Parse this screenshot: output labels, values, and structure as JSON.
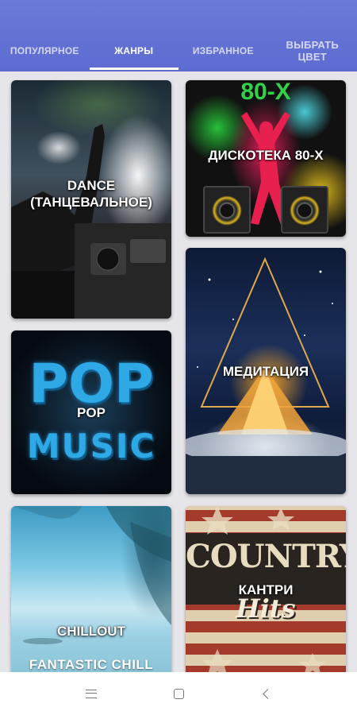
{
  "tabs": [
    {
      "label": "ПОПУЛЯРНОЕ",
      "active": false
    },
    {
      "label": "ЖАНРЫ",
      "active": true
    },
    {
      "label": "ИЗБРАННОЕ",
      "active": false
    },
    {
      "label": "ВЫБРАТЬ ЦВЕТ",
      "active": false
    }
  ],
  "genres": [
    {
      "title": "DANCE (ТАНЦЕВАЛЬНОЕ)"
    },
    {
      "title": "ДИСКОТЕКА 80-Х",
      "art_text": "80-Х"
    },
    {
      "title": "МЕДИТАЦИЯ"
    },
    {
      "title": "POP",
      "art_text_top": "POP",
      "art_text_bottom": "MUSIC"
    },
    {
      "title": "CHILLOUT",
      "art_text": "FANTASTIC CHILL"
    },
    {
      "title": "КАНТРИ",
      "art_text_top": "COUNTRY",
      "art_text_bottom": "Hits"
    }
  ],
  "colors": {
    "header": "#6472d4",
    "background": "#e6e6ea",
    "active_tab": "#ffffff"
  },
  "navbar": {
    "icons": [
      "menu-icon",
      "home-square-icon",
      "back-icon"
    ]
  }
}
